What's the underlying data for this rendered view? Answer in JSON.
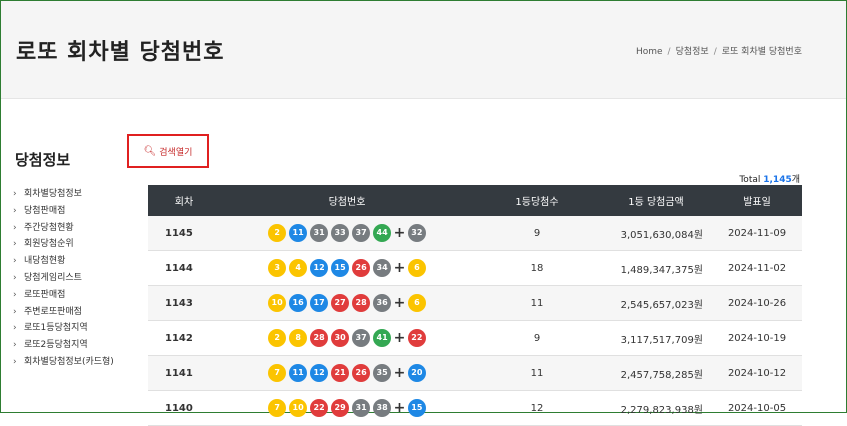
{
  "header": {
    "title": "로또 회차별 당첨번호",
    "breadcrumb": [
      "Home",
      "당첨정보",
      "로또 회차별 당첨번호"
    ]
  },
  "sidebar": {
    "title": "당첨정보",
    "items": [
      "회차별당첨정보",
      "당첨판매점",
      "주간당첨현황",
      "회원당첨순위",
      "내당첨현황",
      "당첨게임리스트",
      "로또판매점",
      "주변로또판매점",
      "로또1등당첨지역",
      "로또2등당첨지역",
      "회차별당첨정보(카드형)"
    ]
  },
  "search": {
    "label": "검색열기",
    "icon": "search-icon"
  },
  "total": {
    "label": "Total",
    "count": "1,145",
    "unit": "개"
  },
  "table": {
    "headers": [
      "회차",
      "당첨번호",
      "1등당첨수",
      "1등 당첨금액",
      "발표일"
    ],
    "rows": [
      {
        "round": "1145",
        "numbers": [
          2,
          11,
          31,
          33,
          37,
          44
        ],
        "bonus": 32,
        "winners": "9",
        "amount": "3,051,630,084원",
        "date": "2024-11-09"
      },
      {
        "round": "1144",
        "numbers": [
          3,
          4,
          12,
          15,
          26,
          34
        ],
        "bonus": 6,
        "winners": "18",
        "amount": "1,489,347,375원",
        "date": "2024-11-02"
      },
      {
        "round": "1143",
        "numbers": [
          10,
          16,
          17,
          27,
          28,
          36
        ],
        "bonus": 6,
        "winners": "11",
        "amount": "2,545,657,023원",
        "date": "2024-10-26"
      },
      {
        "round": "1142",
        "numbers": [
          2,
          8,
          28,
          30,
          37,
          41
        ],
        "bonus": 22,
        "winners": "9",
        "amount": "3,117,517,709원",
        "date": "2024-10-19"
      },
      {
        "round": "1141",
        "numbers": [
          7,
          11,
          12,
          21,
          26,
          35
        ],
        "bonus": 20,
        "winners": "11",
        "amount": "2,457,758,285원",
        "date": "2024-10-12"
      },
      {
        "round": "1140",
        "numbers": [
          7,
          10,
          22,
          29,
          31,
          38
        ],
        "bonus": 15,
        "winners": "12",
        "amount": "2,279,823,938원",
        "date": "2024-10-05"
      }
    ]
  },
  "ball_colors": {
    "1-10": "#fbc400",
    "11-20": "#1e88e5",
    "21-30": "#e03c3c",
    "31-40": "#777c80",
    "41-45": "#34a853"
  }
}
